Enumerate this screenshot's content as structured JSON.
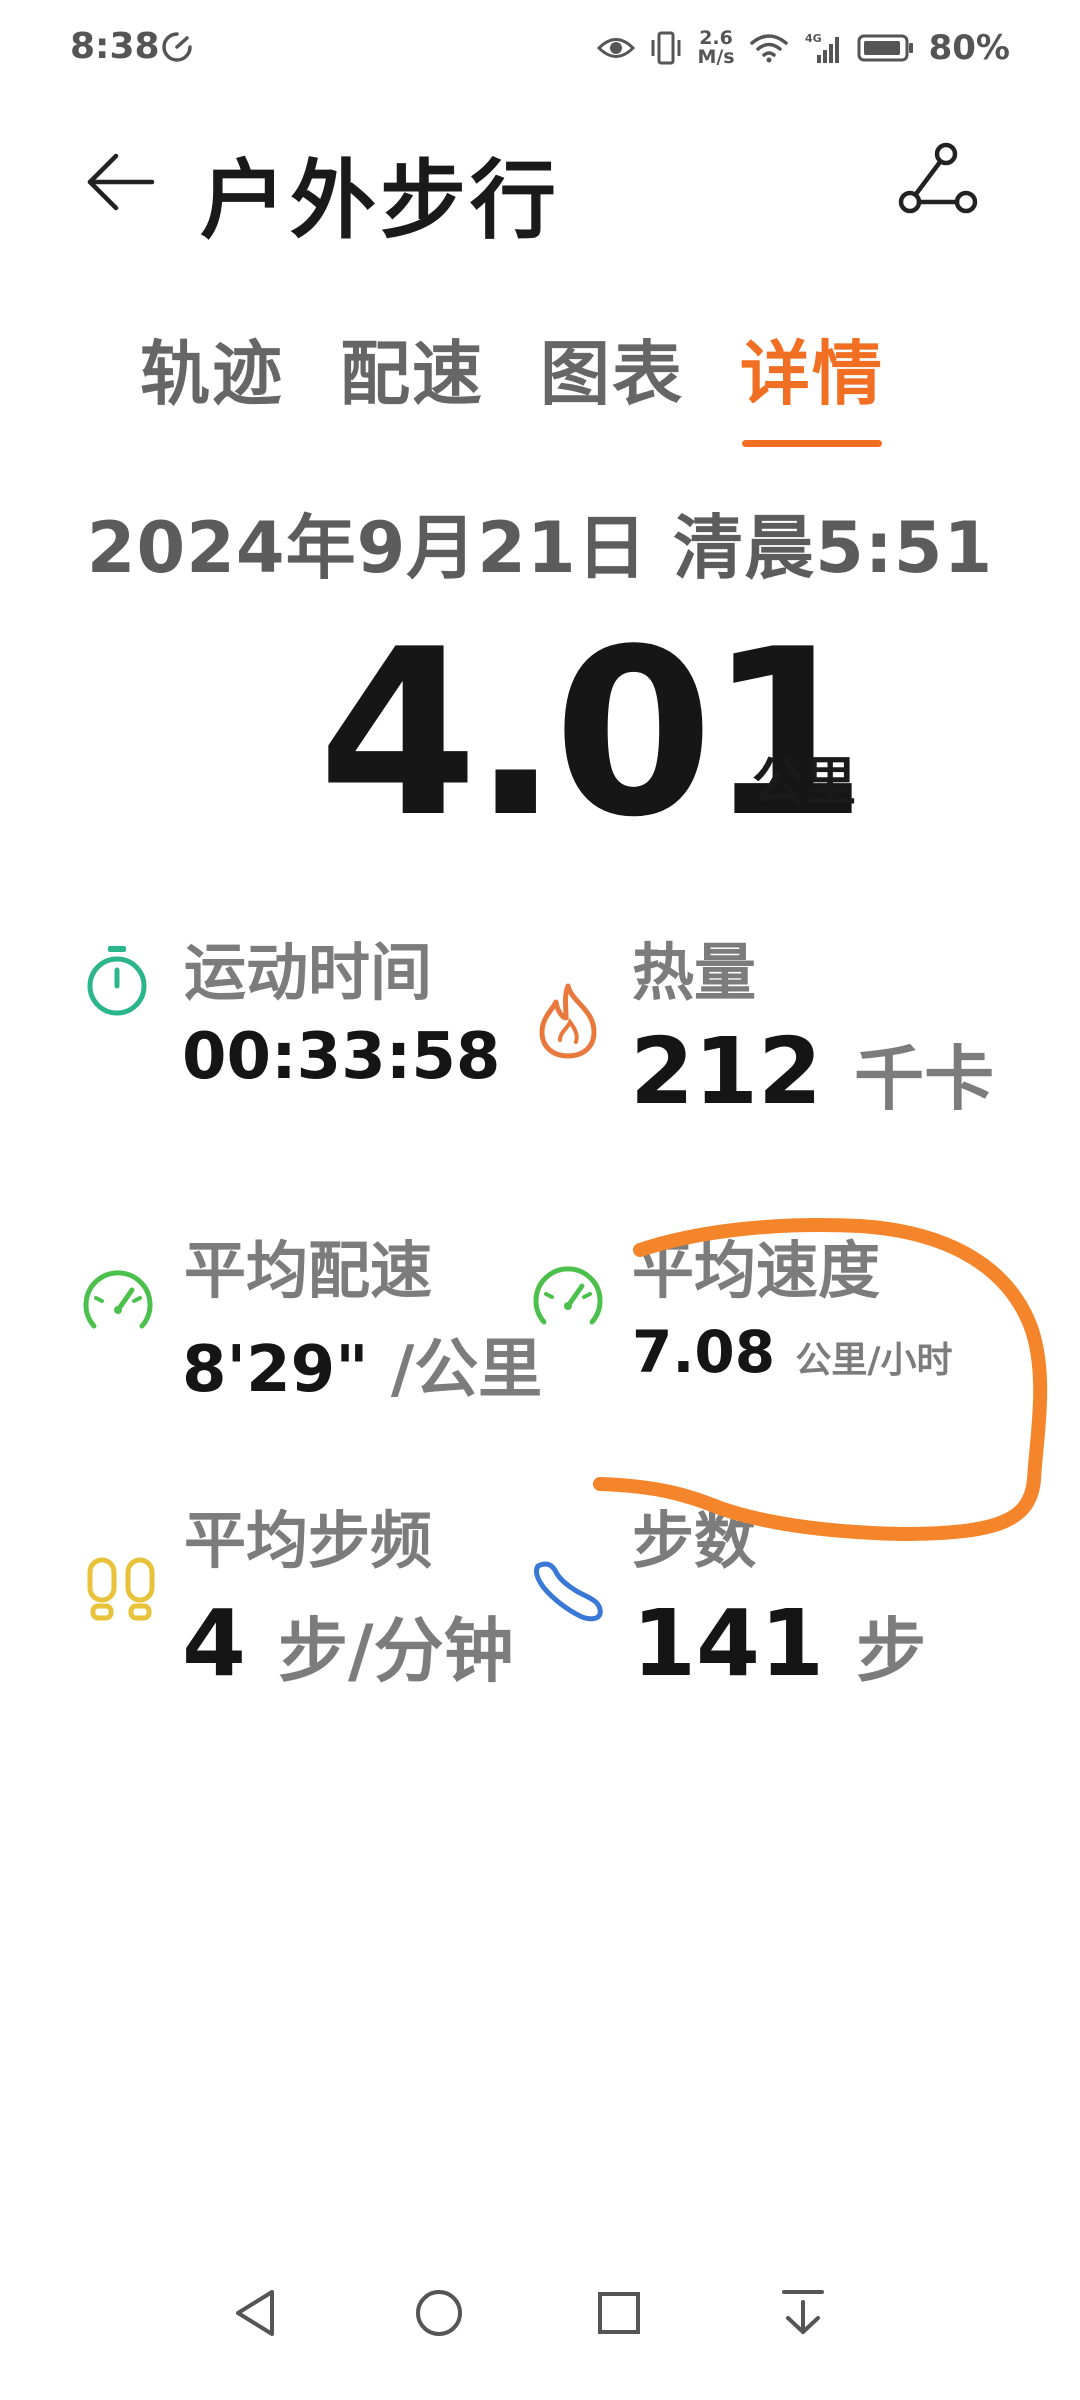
{
  "status_bar": {
    "time": "8:38",
    "net_speed_value": "2.6",
    "net_speed_unit": "M/s",
    "battery": "80%",
    "icons": [
      "speed-clock-icon",
      "eye-icon",
      "vibrate-icon",
      "wifi-icon",
      "signal-4g-icon",
      "battery-icon"
    ]
  },
  "header": {
    "title": "户外步行",
    "back_icon": "arrow-left-icon",
    "share_icon": "route-share-icon"
  },
  "tabs": [
    {
      "label": "轨迹",
      "active": false
    },
    {
      "label": "配速",
      "active": false
    },
    {
      "label": "图表",
      "active": false
    },
    {
      "label": "详情",
      "active": true
    }
  ],
  "summary": {
    "date": "2024年9月21日 清晨5:51",
    "distance": "4.01",
    "distance_unit": "公里"
  },
  "stats": {
    "duration": {
      "label": "运动时间",
      "value": "00:33:58",
      "icon": "stopwatch-icon",
      "color": "#2bb58a"
    },
    "calories": {
      "label": "热量",
      "value": "212",
      "unit": "千卡",
      "icon": "flame-icon",
      "color": "#e8783c"
    },
    "avg_pace": {
      "label": "平均配速",
      "value": "8'29\"",
      "unit": "/公里",
      "icon": "speedometer-icon",
      "color": "#4cc04c"
    },
    "avg_speed": {
      "label": "平均速度",
      "value": "7.08",
      "unit": "公里/小时",
      "icon": "speedometer-icon",
      "color": "#4cc04c"
    },
    "cadence": {
      "label": "平均步频",
      "value": "4",
      "unit": "步/分钟",
      "icon": "footprints-icon",
      "color": "#e8c23a"
    },
    "steps": {
      "label": "步数",
      "value": "141",
      "unit": "步",
      "icon": "shoe-icon",
      "color": "#3a78d8"
    }
  },
  "colors": {
    "accent": "#f06f22",
    "annotation": "#f5852a"
  },
  "nav_bar": {
    "icons": [
      "back-triangle-icon",
      "home-circle-icon",
      "recents-square-icon",
      "notification-pull-icon"
    ]
  }
}
